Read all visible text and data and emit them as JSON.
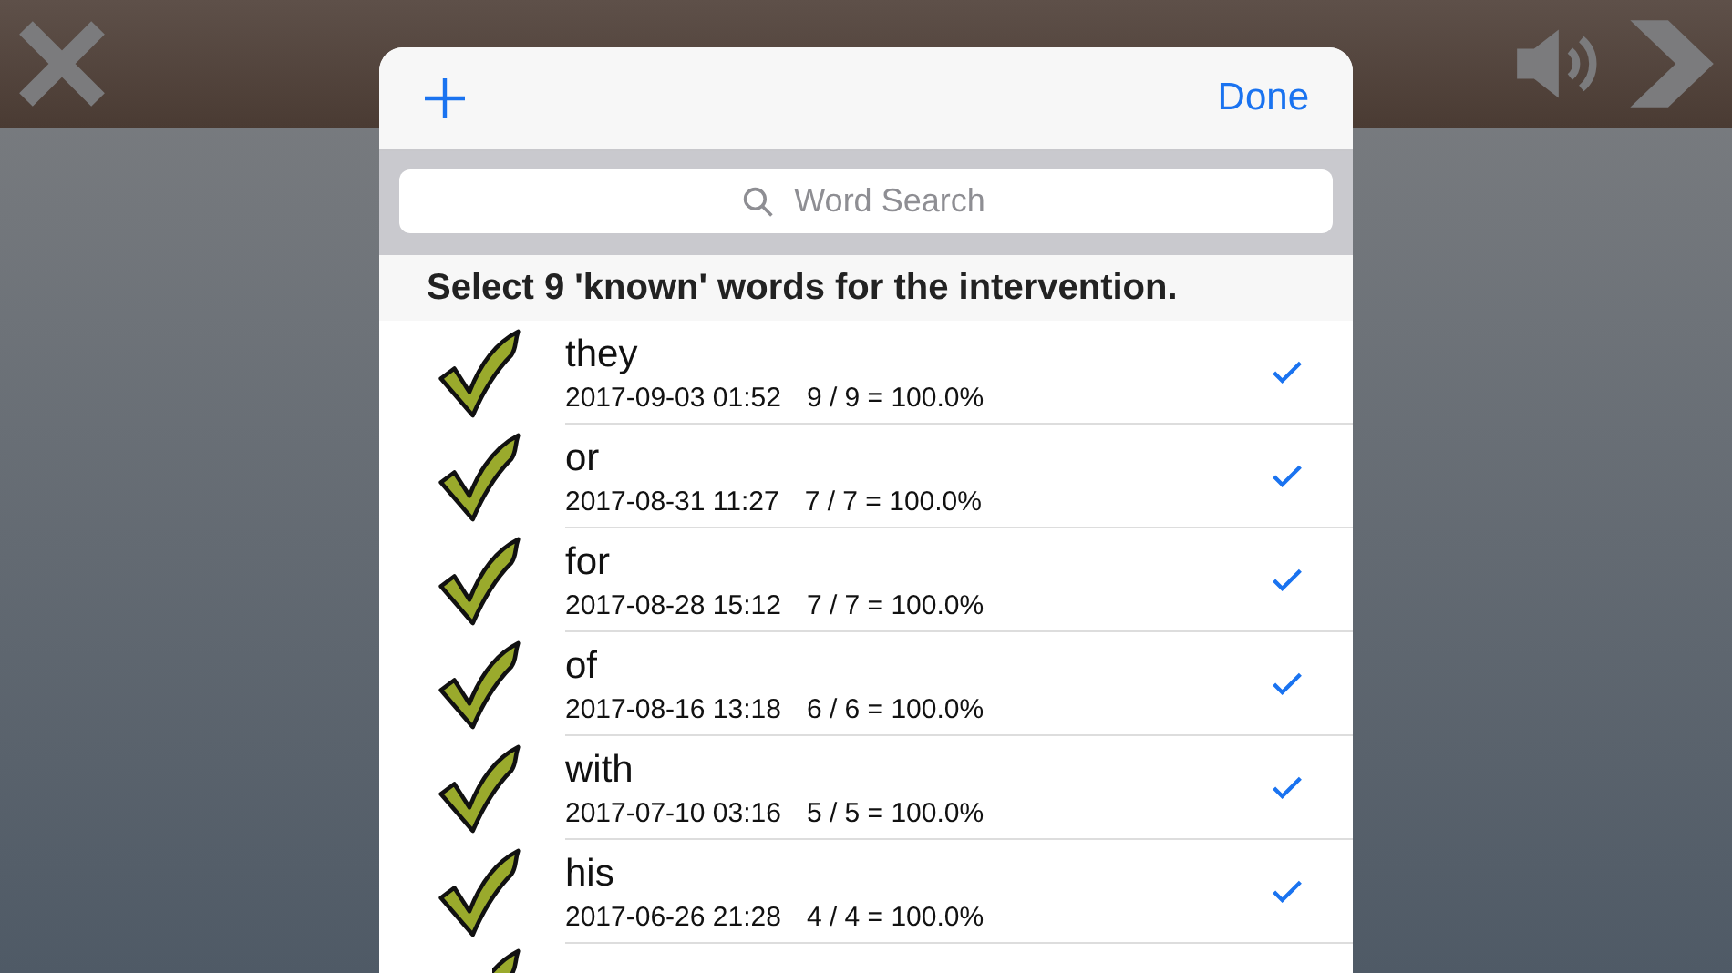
{
  "header": {
    "done": "Done"
  },
  "search": {
    "placeholder": "Word Search"
  },
  "section_header": "Select 9 'known' words for the intervention.",
  "words": [
    {
      "word": "they",
      "date": "2017-09-03 01:52",
      "score": "9 / 9 = 100.0%",
      "selected": true
    },
    {
      "word": "or",
      "date": "2017-08-31 11:27",
      "score": "7 / 7 = 100.0%",
      "selected": true
    },
    {
      "word": "for",
      "date": "2017-08-28 15:12",
      "score": "7 / 7 = 100.0%",
      "selected": true
    },
    {
      "word": "of",
      "date": "2017-08-16 13:18",
      "score": "6 / 6 = 100.0%",
      "selected": true
    },
    {
      "word": "with",
      "date": "2017-07-10 03:16",
      "score": "5 / 5 = 100.0%",
      "selected": true
    },
    {
      "word": "his",
      "date": "2017-06-26 21:28",
      "score": "4 / 4 = 100.0%",
      "selected": true
    }
  ]
}
